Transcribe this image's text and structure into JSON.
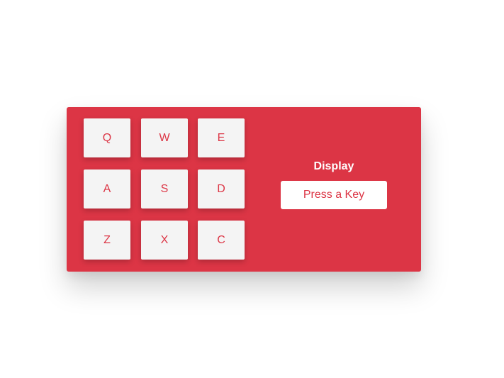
{
  "colors": {
    "panel": "#dc3545",
    "pad_background": "#f4f4f4",
    "pad_text": "#dc3545",
    "display_title_text": "#ffffff",
    "display_box_background": "#ffffff",
    "display_box_text": "#dc3545"
  },
  "pads": [
    {
      "key": "Q"
    },
    {
      "key": "W"
    },
    {
      "key": "E"
    },
    {
      "key": "A"
    },
    {
      "key": "S"
    },
    {
      "key": "D"
    },
    {
      "key": "Z"
    },
    {
      "key": "X"
    },
    {
      "key": "C"
    }
  ],
  "display": {
    "title": "Display",
    "text": "Press a Key"
  }
}
